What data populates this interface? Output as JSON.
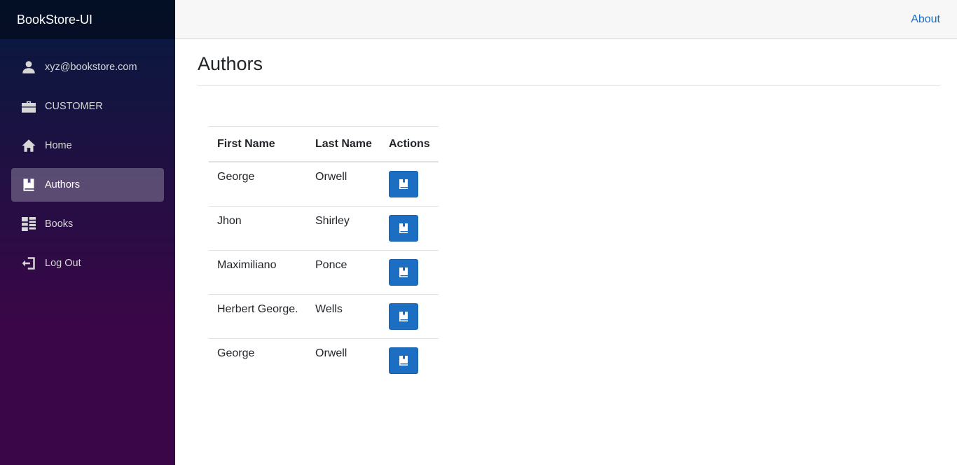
{
  "app": {
    "title": "BookStore-UI"
  },
  "topbar": {
    "about_label": "About"
  },
  "sidebar": {
    "items": [
      {
        "label": "xyz@bookstore.com",
        "icon": "person-icon"
      },
      {
        "label": "CUSTOMER",
        "icon": "briefcase-icon"
      },
      {
        "label": "Home",
        "icon": "home-icon"
      },
      {
        "label": "Authors",
        "icon": "book-icon",
        "active": true
      },
      {
        "label": "Books",
        "icon": "list-icon"
      },
      {
        "label": "Log Out",
        "icon": "logout-icon"
      }
    ]
  },
  "page": {
    "title": "Authors"
  },
  "table": {
    "headers": [
      "First Name",
      "Last Name",
      "Actions"
    ],
    "rows": [
      {
        "first": "George",
        "last": "Orwell",
        "action_icon": "book-icon"
      },
      {
        "first": "Jhon",
        "last": "Shirley",
        "action_icon": "book-icon"
      },
      {
        "first": "Maximiliano",
        "last": "Ponce",
        "action_icon": "book-icon"
      },
      {
        "first": "Herbert George.",
        "last": "Wells",
        "action_icon": "book-icon"
      },
      {
        "first": "George",
        "last": "Orwell",
        "action_icon": "book-icon"
      }
    ]
  },
  "colors": {
    "primary": "#1b6ec2",
    "sidebar_top": "#051a3e",
    "sidebar_bottom": "#3a0647"
  }
}
